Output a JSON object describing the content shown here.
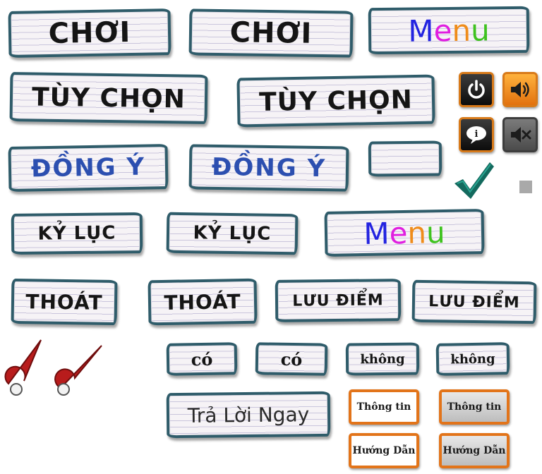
{
  "buttons": {
    "choi": "CHƠI",
    "menu": "Menu",
    "menu_letters": [
      "M",
      "e",
      "n",
      "u"
    ],
    "tuy_chon": "TÙY CHỌN",
    "dong_y": "ĐỒNG Ý",
    "ky_luc": "KỶ LỤC",
    "thoat": "THOÁT",
    "luu_diem": "LƯU ĐIỂM",
    "co": "có",
    "khong": "không",
    "tra_loi_ngay": "Trả Lời Ngay",
    "thong_tin": "Thông tin",
    "huong_dan": "Hướng Dẫn"
  },
  "icons": {
    "power": "power-icon",
    "sound_on": "speaker-on-icon",
    "info": "info-bubble-icon",
    "sound_off": "speaker-muted-icon",
    "check": "checkmark-icon",
    "pointer": "clock-hand-icon",
    "info_glyph": "i"
  },
  "colors": {
    "border": "#2f5c6a",
    "paper": "#f6f3f6",
    "lines": "#c9c5dc",
    "blue_text": "#2c4fb0",
    "menu_m": "#2323e0",
    "menu_e": "#e01fe0",
    "menu_n": "#ef8c1a",
    "menu_u": "#3fc21f",
    "orange": "#e2741a",
    "check": "#136a5e",
    "needle": "#b81c1c"
  }
}
